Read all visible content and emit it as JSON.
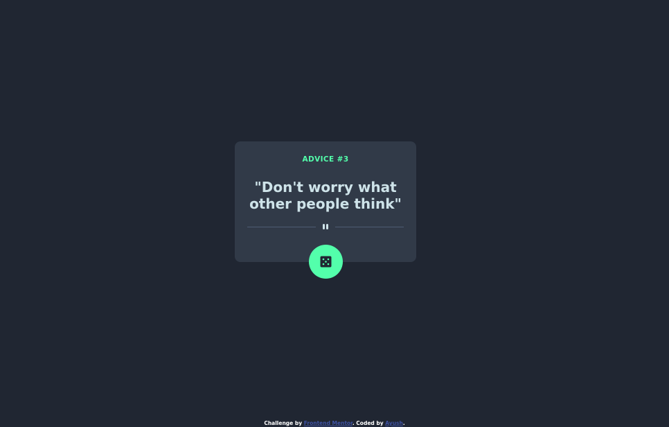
{
  "card": {
    "advice_id": "ADVICE #3",
    "quote": "\"Don't worry what other people think\"",
    "divider_icon": "pause-icon",
    "button_icon": "dice-icon"
  },
  "attribution": {
    "prefix": "Challenge by ",
    "challenge_link": "Frontend Mentor",
    "middle": ". Coded by ",
    "coder_link": "Ayush",
    "suffix": "."
  },
  "colors": {
    "background": "#202632",
    "card": "#313a48",
    "accent": "#53ffab",
    "quote_text": "#cee3e9",
    "divider": "#4f5d74"
  }
}
